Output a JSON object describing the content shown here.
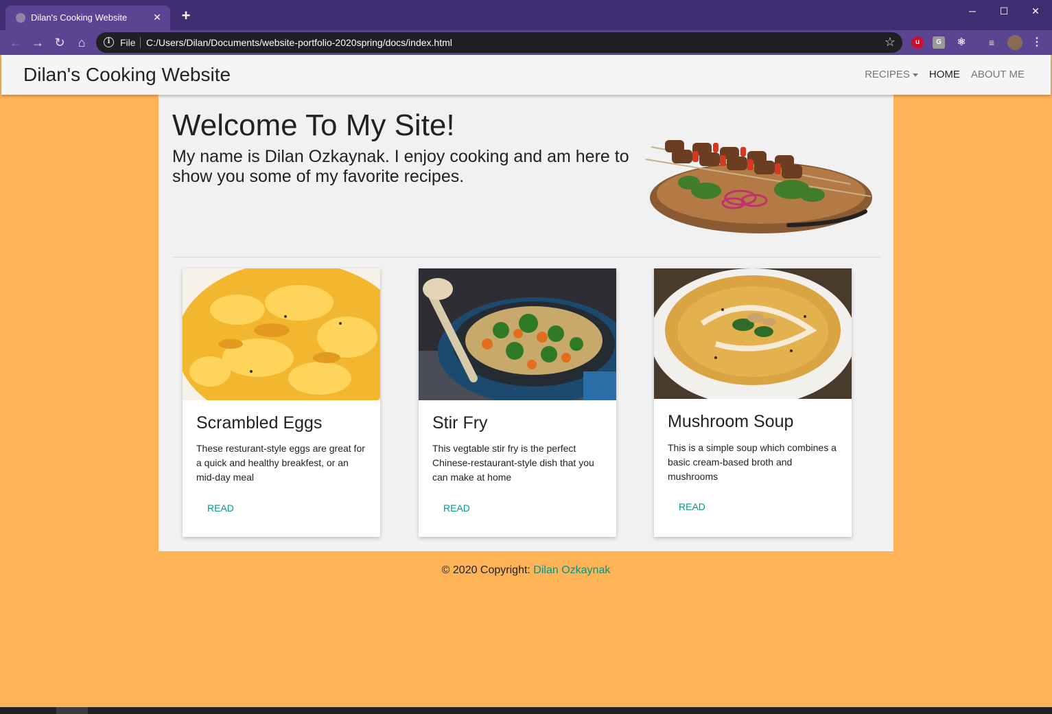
{
  "browser": {
    "tab_title": "Dilan's Cooking Website",
    "scheme_label": "File",
    "url": "C:/Users/Dilan/Documents/website-portfolio-2020spring/docs/index.html",
    "accent_color": "#3f2e72"
  },
  "navbar": {
    "brand": "Dilan's Cooking Website",
    "links": [
      {
        "label": "RECIPES",
        "dropdown": true
      },
      {
        "label": "HOME",
        "active": true
      },
      {
        "label": "ABOUT ME"
      }
    ]
  },
  "hero": {
    "title": "Welcome To My Site!",
    "text": "My name is Dilan Ozkaynak. I enjoy cooking and am here to show you some of my favorite recipes."
  },
  "cards": [
    {
      "title": "Scrambled Eggs",
      "text": "These resturant-style eggs are great for a quick and healthy breakfest, or an mid-day meal",
      "link": "READ"
    },
    {
      "title": "Stir Fry",
      "text": "This vegtable stir fry is the perfect Chinese-restaurant-style dish that you can make at home",
      "link": "READ"
    },
    {
      "title": "Mushroom Soup",
      "text": "This is a simple soup which combines a basic cream-based broth and mushrooms",
      "link": "READ"
    }
  ],
  "footer": {
    "prefix": "© 2020 Copyright: ",
    "link": "Dilan Ozkaynak"
  },
  "colors": {
    "page_background": "#ffb357",
    "link": "#009688"
  }
}
